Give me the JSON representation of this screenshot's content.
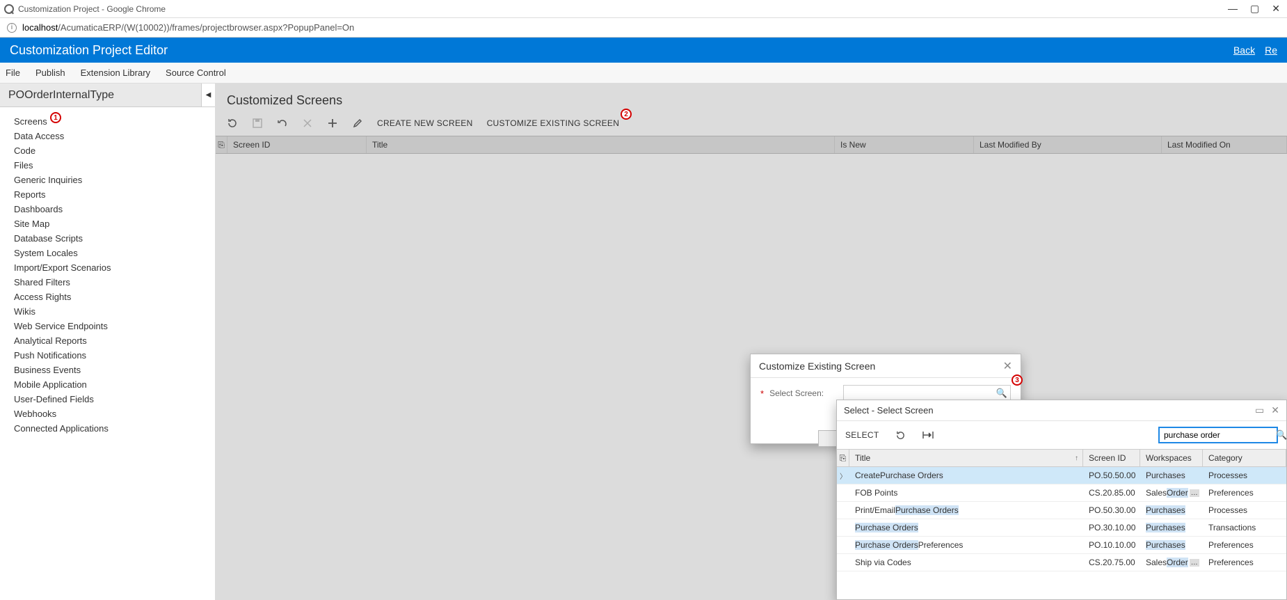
{
  "chrome": {
    "title": "Customization Project - Google Chrome",
    "url_host": "localhost",
    "url_path": "/AcumaticaERP/(W(10002))/frames/projectbrowser.aspx?PopupPanel=On"
  },
  "app": {
    "title": "Customization Project Editor",
    "back": "Back",
    "reload": "Re"
  },
  "menu": {
    "items": [
      "File",
      "Publish",
      "Extension Library",
      "Source Control"
    ]
  },
  "project_name": "POOrderInternalType",
  "nav_items": [
    "Screens",
    "Data Access",
    "Code",
    "Files",
    "Generic Inquiries",
    "Reports",
    "Dashboards",
    "Site Map",
    "Database Scripts",
    "System Locales",
    "Import/Export Scenarios",
    "Shared Filters",
    "Access Rights",
    "Wikis",
    "Web Service Endpoints",
    "Analytical Reports",
    "Push Notifications",
    "Business Events",
    "Mobile Application",
    "User-Defined Fields",
    "Webhooks",
    "Connected Applications"
  ],
  "annotations": {
    "a1": "1",
    "a2": "2",
    "a3": "3"
  },
  "page": {
    "title": "Customized Screens",
    "btn_new": "CREATE NEW SCREEN",
    "btn_customize": "CUSTOMIZE EXISTING SCREEN",
    "columns": {
      "c1": "Screen ID",
      "c2": "Title",
      "c3": "Is New",
      "c4": "Last Modified By",
      "c5": "Last Modified On"
    }
  },
  "modal1": {
    "title": "Customize Existing Screen",
    "label": "Select Screen:"
  },
  "modal2": {
    "title": "Select - Select Screen",
    "select": "SELECT",
    "search_value": "purchase order",
    "columns": {
      "c1": "Title",
      "c2": "Screen ID",
      "c3": "Workspaces",
      "c4": "Category"
    },
    "rows": [
      {
        "title_pre": "Create ",
        "title_hl": "Purchase Orders",
        "title_post": "",
        "id": "PO.50.50.00",
        "ws": "Purchases",
        "ws_hl": true,
        "ws_more": false,
        "cat": "Processes"
      },
      {
        "title_pre": "FOB Points",
        "title_hl": "",
        "title_post": "",
        "id": "CS.20.85.00",
        "ws": "Sales Order",
        "ws_hl": false,
        "ws_more": true,
        "cat": "Preferences"
      },
      {
        "title_pre": "Print/Email ",
        "title_hl": "Purchase Orders",
        "title_post": "",
        "id": "PO.50.30.00",
        "ws": "Purchases",
        "ws_hl": true,
        "ws_more": false,
        "cat": "Processes"
      },
      {
        "title_pre": "",
        "title_hl": "Purchase Orders",
        "title_post": "",
        "id": "PO.30.10.00",
        "ws": "Purchases",
        "ws_hl": true,
        "ws_more": false,
        "cat": "Transactions"
      },
      {
        "title_pre": "",
        "title_hl": "Purchase Orders",
        "title_post": " Preferences",
        "id": "PO.10.10.00",
        "ws": "Purchases",
        "ws_hl": true,
        "ws_more": false,
        "cat": "Preferences"
      },
      {
        "title_pre": "Ship via Codes",
        "title_hl": "",
        "title_post": "",
        "id": "CS.20.75.00",
        "ws": "Sales Order",
        "ws_hl": false,
        "ws_more": true,
        "cat": "Preferences"
      }
    ]
  }
}
